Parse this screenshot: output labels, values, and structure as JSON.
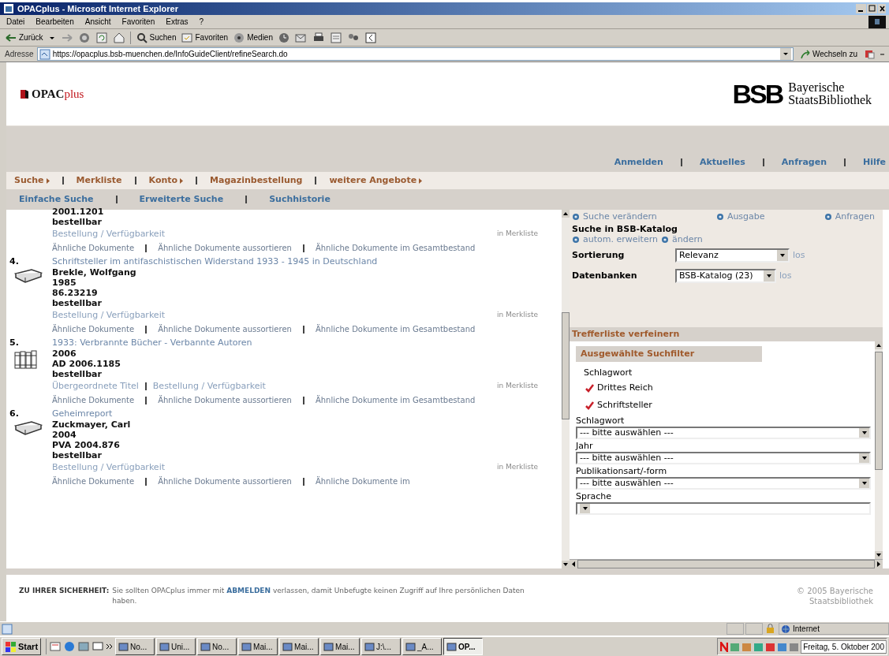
{
  "window": {
    "title": "OPACplus - Microsoft Internet Explorer"
  },
  "menu_bar": [
    "Datei",
    "Bearbeiten",
    "Ansicht",
    "Favoriten",
    "Extras",
    "?"
  ],
  "toolbar": [
    {
      "label": "Zurück"
    },
    {
      "label": "Suchen"
    },
    {
      "label": "Favoriten"
    },
    {
      "label": "Medien"
    }
  ],
  "address_bar": {
    "label": "Adresse",
    "url": "https://opacplus.bsb-muenchen.de/InfoGuideClient/refineSearch.do",
    "go": "Wechseln zu"
  },
  "site_header": {
    "logo_main": "OPAC",
    "logo_accent": "plus",
    "library_mark": "BSB",
    "library_name": [
      "Bayerische",
      "StaatsBibliothek"
    ]
  },
  "top_links": [
    "Anmelden",
    "Aktuelles",
    "Anfragen",
    "Hilfe"
  ],
  "main_nav": [
    {
      "label": "Suche",
      "has_submenu": true
    },
    {
      "label": "Merkliste",
      "has_submenu": false
    },
    {
      "label": "Konto",
      "has_submenu": true
    },
    {
      "label": "Magazinbestellung",
      "has_submenu": false
    },
    {
      "label": "weitere Angebote",
      "has_submenu": true
    }
  ],
  "sub_nav": [
    "Einfache Suche",
    "Erweiterte Suche",
    "Suchhistorie"
  ],
  "results": [
    {
      "details": [
        "2001.1201",
        "bestellbar"
      ],
      "links": [
        "Bestellung / Verfügbarkeit"
      ],
      "merkliste": "in Merkliste",
      "similar": [
        "Ähnliche Dokumente",
        "Ähnliche Dokumente aussortieren",
        "Ähnliche Dokumente im Gesamtbestand"
      ]
    },
    {
      "number": "4.",
      "kind": "book",
      "title": "Schriftsteller im antifaschistischen Widerstand 1933 - 1945 in Deutschland",
      "details": [
        "Brekle, Wolfgang",
        "1985",
        "86.23219",
        "bestellbar"
      ],
      "links": [
        "Bestellung / Verfügbarkeit"
      ],
      "merkliste": "in Merkliste",
      "similar": [
        "Ähnliche Dokumente",
        "Ähnliche Dokumente aussortieren",
        "Ähnliche Dokumente im Gesamtbestand"
      ]
    },
    {
      "number": "5.",
      "kind": "multivolume",
      "title": "1933: Verbrannte Bücher - Verbannte Autoren",
      "details": [
        "2006",
        "AD 2006.1185",
        "bestellbar"
      ],
      "links": [
        "Übergeordnete Titel",
        "Bestellung / Verfügbarkeit"
      ],
      "merkliste": "in Merkliste",
      "similar": [
        "Ähnliche Dokumente",
        "Ähnliche Dokumente aussortieren",
        "Ähnliche Dokumente im Gesamtbestand"
      ]
    },
    {
      "number": "6.",
      "kind": "book",
      "title": "Geheimreport",
      "details": [
        "Zuckmayer, Carl",
        "2004",
        "PVA 2004.876",
        "bestellbar"
      ],
      "links": [
        "Bestellung / Verfügbarkeit"
      ],
      "merkliste": "in Merkliste",
      "similar": [
        "Ähnliche Dokumente",
        "Ähnliche Dokumente aussortieren",
        "Ähnliche Dokumente im"
      ]
    }
  ],
  "side_panel": {
    "tabs": [
      "Suche verändern",
      "Ausgabe",
      "Anfragen"
    ],
    "search_in": "Suche in BSB-Katalog",
    "search_links": [
      "autom. erweitern",
      "ändern"
    ],
    "settings": [
      {
        "label": "Sortierung",
        "value": "Relevanz",
        "go": "los"
      },
      {
        "label": "Datenbanken",
        "value": "BSB-Katalog (23)",
        "go": "los"
      }
    ],
    "refine_title": "Trefferliste verfeinern",
    "selected_title": "Ausgewählte Suchfilter",
    "selected_group": "Schlagwort",
    "selected_filters": [
      {
        "label": "Drittes Reich",
        "checked": true
      },
      {
        "label": "Schriftsteller",
        "checked": true
      }
    ],
    "filters": [
      {
        "label": "Schlagwort",
        "value": "--- bitte auswählen ---"
      },
      {
        "label": "Jahr",
        "value": "--- bitte auswählen ---"
      },
      {
        "label": "Publikationsart/-form",
        "value": "--- bitte auswählen ---"
      },
      {
        "label": "Sprache"
      }
    ]
  },
  "footer": {
    "label": "ZU IHRER SICHERHEIT:",
    "text": "Sie sollten OPACplus immer mit **ABMELDEN** verlassen, damit Unbefugte keinen Zugriff auf Ihre persönlichen Daten haben.",
    "copyright": "© 2005 Bayerische Staatsbibliothek"
  },
  "status_bar": {
    "zone": "Internet"
  },
  "taskbar": {
    "start": "Start",
    "buttons": [
      {
        "label": "No...",
        "selected": false
      },
      {
        "label": "Uni...",
        "selected": false
      },
      {
        "label": "No...",
        "selected": false
      },
      {
        "label": "Mai...",
        "selected": false
      },
      {
        "label": "Mai...",
        "selected": false
      },
      {
        "label": "Mai...",
        "selected": false
      },
      {
        "label": "J:\\...",
        "selected": false
      },
      {
        "label": "_A...",
        "selected": false
      },
      {
        "label": "OP...",
        "selected": true
      }
    ],
    "clock": "Freitag, 5. Oktober 200"
  }
}
